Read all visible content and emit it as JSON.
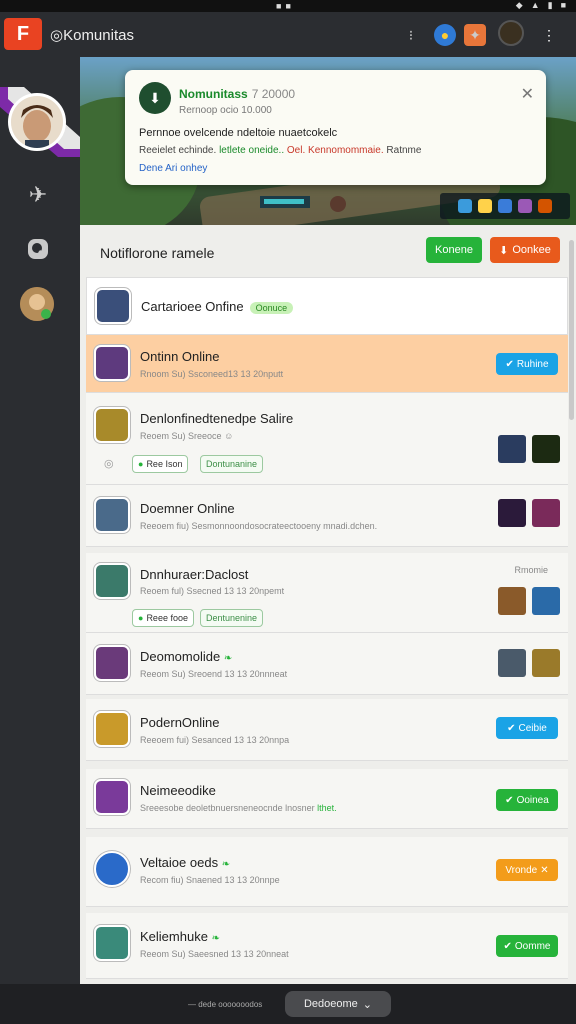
{
  "app": {
    "title": "Komunitas",
    "logo_glyph": "F",
    "colors": {
      "brand": "#e94322",
      "green": "#26b33a",
      "orange": "#e85a1c",
      "blue": "#1aa3e6",
      "highlight": "#fdcfa2"
    }
  },
  "statusbar": {
    "icons": [
      "wifi-icon",
      "signal-icon",
      "battery-icon"
    ]
  },
  "topbar": {
    "icons": [
      "more-icon",
      "notification-icon",
      "game-icon",
      "avatar",
      "overflow-menu-icon"
    ]
  },
  "sidebar": {
    "icons": [
      "profile-avatar",
      "plane-icon",
      "search-icon",
      "small-avatar"
    ]
  },
  "toast": {
    "title": "Nomunitass",
    "time": "7 20000",
    "subtitle": "Rernoop ocio 10.000",
    "body": "Pernnoe ovelcende ndeltoie nuaetcokelc",
    "line2_prefix": "Reeielet echinde.",
    "line2_green": "letlete oneide..",
    "line2_red": "Oel. Kennomommaie.",
    "line2_suffix": "Ratnme",
    "link": "Dene Ari onhey"
  },
  "panel": {
    "title": "Notiflorone ramele",
    "btn_green": "Konene",
    "btn_orange": "Oonkee"
  },
  "rows": [
    {
      "name": "Cartarioee Onfine",
      "tag": "Oonuce",
      "sub": ""
    },
    {
      "name": "Ontinn Online",
      "sub": "Rnoom Su) Ssconeed13 13 20nputt",
      "button": "Ruhine"
    },
    {
      "name": "Denlonfinedtenedpe Salire",
      "sub": "Reoem Su) Sreeoce",
      "chip1": "Ree Ison",
      "chip2": "Dontunanine"
    },
    {
      "name": "Doemner Online",
      "sub": "Reeoem fiu) Sesmonnoondosocrateectooeny mnadi.dchen."
    },
    {
      "name": "Dnnhuraer:Daclost",
      "sub": "Reoem ful) Ssecned 13 13 20npemt",
      "chip1": "Reee fooe",
      "chip2": "Dentunenine",
      "label": "Rmomie"
    },
    {
      "name": "Deomomolide",
      "sub": "Reeom Su) Sreoend 13 13 20nnneat"
    },
    {
      "name": "PodernOnline",
      "sub": "Reeoem fui) Sesanced 13 13 20nnpa",
      "button": "Ceibie"
    },
    {
      "name": "Neimeeodike",
      "sub": "Sreeesobe deoletbnuersneneocnde lnosner",
      "sub_green": "lthet.",
      "button": "Ooinea"
    },
    {
      "name": "Veltaioe oeds",
      "sub": "Recom fiu) Snaened 13 13 20nnpe",
      "button": "Vronde"
    },
    {
      "name": "Keliemhuke",
      "sub": "Reeom Su) Saeesned 13 13 20nneat",
      "button": "Oomme"
    }
  ],
  "bottombar": {
    "label": "— dede ooooooodos",
    "pill": "Dedoeome"
  }
}
